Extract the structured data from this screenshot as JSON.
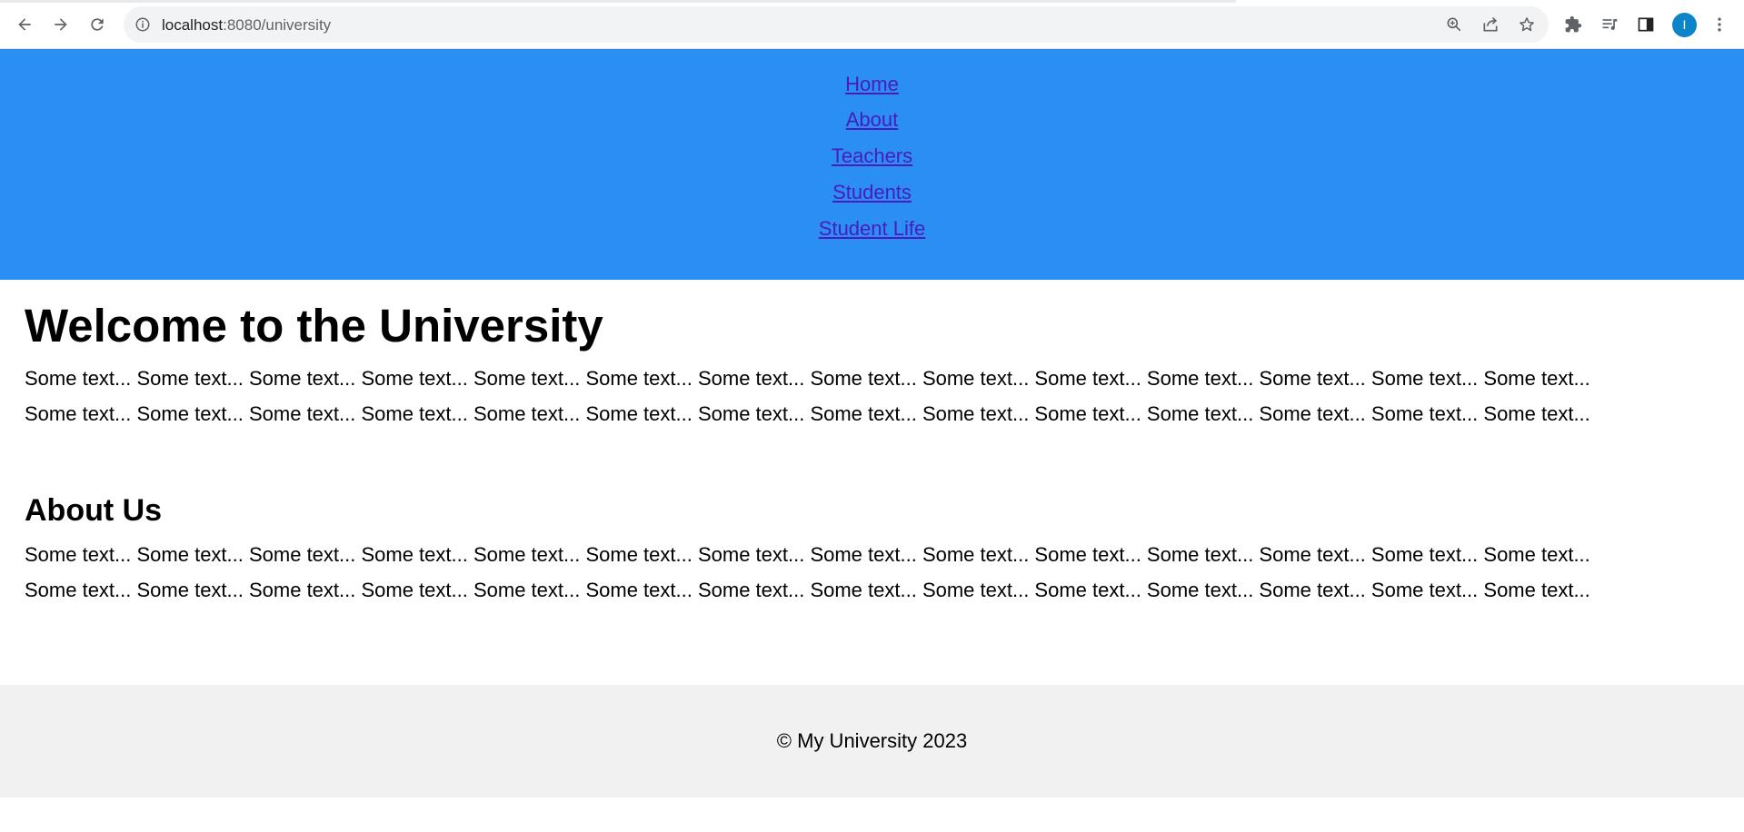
{
  "browser": {
    "url_host": "localhost",
    "url_path": ":8080/university",
    "profile_initial": "I",
    "icons": {
      "back": "back-arrow-icon",
      "forward": "forward-arrow-icon",
      "reload": "reload-icon",
      "site_info": "info-icon",
      "zoom": "zoom-icon",
      "share": "share-icon",
      "bookmark": "star-icon",
      "extensions": "puzzle-icon",
      "reading_list": "reading-list-icon",
      "side_panel": "side-panel-icon",
      "menu": "kebab-menu-icon"
    },
    "colors": {
      "avatar": "#0b84c9"
    }
  },
  "header": {
    "background": "#2a8ef3",
    "nav": [
      {
        "label": "Home"
      },
      {
        "label": "About"
      },
      {
        "label": "Teachers"
      },
      {
        "label": "Students"
      },
      {
        "label": "Student Life"
      }
    ],
    "link_color": "#4b1bbd"
  },
  "main": {
    "title": "Welcome to the University",
    "intro_lines": [
      "Some text... Some text... Some text... Some text... Some text... Some text... Some text... Some text... Some text... Some text... Some text... Some text... Some text... Some text...",
      "Some text... Some text... Some text... Some text... Some text... Some text... Some text... Some text... Some text... Some text... Some text... Some text... Some text... Some text..."
    ],
    "about": {
      "title": "About Us",
      "lines": [
        "Some text... Some text... Some text... Some text... Some text... Some text... Some text... Some text... Some text... Some text... Some text... Some text... Some text... Some text...",
        "Some text... Some text... Some text... Some text... Some text... Some text... Some text... Some text... Some text... Some text... Some text... Some text... Some text... Some text..."
      ]
    }
  },
  "footer": {
    "copyright": "© My University 2023",
    "background": "#f1f1f1"
  }
}
